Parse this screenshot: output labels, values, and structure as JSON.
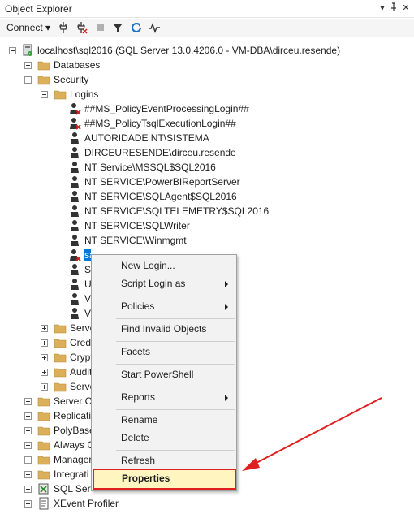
{
  "window": {
    "title": "Object Explorer"
  },
  "toolbar": {
    "connect_label": "Connect"
  },
  "tree": {
    "root": "localhost\\sql2016 (SQL Server 13.0.4206.0 - VM-DBA\\dirceu.resende)",
    "databases": "Databases",
    "security": "Security",
    "logins": "Logins",
    "login_items": [
      "##MS_PolicyEventProcessingLogin##",
      "##MS_PolicyTsqlExecutionLogin##",
      "AUTORIDADE NT\\SISTEMA",
      "DIRCEURESENDE\\dirceu.resende",
      "NT Service\\MSSQL$SQL2016",
      "NT SERVICE\\PowerBIReportServer",
      "NT SERVICE\\SQLAgent$SQL2016",
      "NT SERVICE\\SQLTELEMETRY$SQL2016",
      "NT SERVICE\\SQLWriter",
      "NT SERVICE\\Winmgmt",
      "sa",
      "SQ",
      "U",
      "VI",
      "VI"
    ],
    "security_children": [
      "Serve",
      "Crede",
      "Crypt",
      "Audit",
      "Serve"
    ],
    "top_level": [
      "Server Ob",
      "Replicatio",
      "PolyBase",
      "Always O",
      "Manager",
      "Integrati",
      "SQL Serve",
      "XEvent Profiler"
    ]
  },
  "context_menu": {
    "items": [
      "New Login...",
      "Script Login as",
      "Policies",
      "Find Invalid Objects",
      "Facets",
      "Start PowerShell",
      "Reports",
      "Rename",
      "Delete",
      "Refresh",
      "Properties"
    ]
  },
  "colors": {
    "selection": "#0078d7",
    "annotation": "#e02020",
    "highlight_fill": "#fff5c0"
  }
}
